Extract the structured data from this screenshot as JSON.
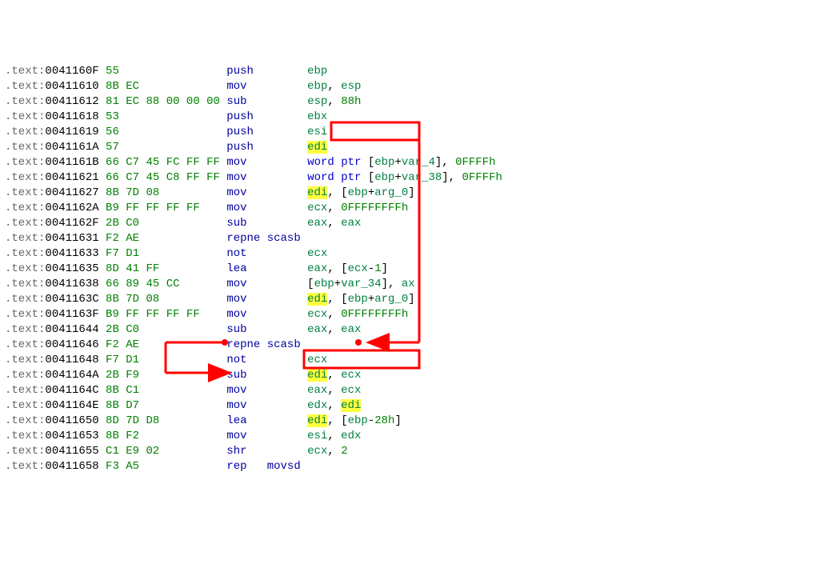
{
  "seg": ".text:",
  "rows": [
    {
      "addr": "0041160F",
      "bytes": [
        "55"
      ],
      "m": "push",
      "ops": [
        [
          "reg",
          "ebp"
        ]
      ]
    },
    {
      "addr": "00411610",
      "bytes": [
        "8B",
        "EC"
      ],
      "m": "mov",
      "ops": [
        [
          "reg",
          "ebp"
        ],
        [
          "punc",
          ", "
        ],
        [
          "reg",
          "esp"
        ]
      ]
    },
    {
      "addr": "00411612",
      "bytes": [
        "81",
        "EC",
        "88",
        "00",
        "00",
        "00"
      ],
      "m": "sub",
      "ops": [
        [
          "reg",
          "esp"
        ],
        [
          "punc",
          ", "
        ],
        [
          "num",
          "88h"
        ]
      ]
    },
    {
      "addr": "00411618",
      "bytes": [
        "53"
      ],
      "m": "push",
      "ops": [
        [
          "reg",
          "ebx"
        ]
      ]
    },
    {
      "addr": "00411619",
      "bytes": [
        "56"
      ],
      "m": "push",
      "ops": [
        [
          "reg",
          "esi"
        ]
      ]
    },
    {
      "addr": "0041161A",
      "bytes": [
        "57"
      ],
      "m": "push",
      "ops": [
        [
          "edi-hl",
          "edi"
        ]
      ]
    },
    {
      "addr": "0041161B",
      "bytes": [
        "66",
        "C7",
        "45",
        "FC",
        "FF",
        "FF"
      ],
      "m": "mov",
      "ops": [
        [
          "blueop",
          "word ptr "
        ],
        [
          "punc",
          "["
        ],
        [
          "reg",
          "ebp"
        ],
        [
          "punc",
          "+"
        ],
        [
          "reg",
          "var_4"
        ],
        [
          "punc",
          "]"
        ],
        [
          "punc",
          ", "
        ],
        [
          "num",
          "0FFFFh"
        ]
      ]
    },
    {
      "addr": "00411621",
      "bytes": [
        "66",
        "C7",
        "45",
        "C8",
        "FF",
        "FF"
      ],
      "m": "mov",
      "ops": [
        [
          "blueop",
          "word ptr "
        ],
        [
          "punc",
          "["
        ],
        [
          "reg",
          "ebp"
        ],
        [
          "punc",
          "+"
        ],
        [
          "reg",
          "var_38"
        ],
        [
          "punc",
          "]"
        ],
        [
          "punc",
          ", "
        ],
        [
          "num",
          "0FFFFh"
        ]
      ]
    },
    {
      "addr": "00411627",
      "bytes": [
        "8B",
        "7D",
        "08"
      ],
      "m": "mov",
      "ops": [
        [
          "edi-hl",
          "edi"
        ],
        [
          "punc",
          ", "
        ],
        [
          "punc",
          "["
        ],
        [
          "reg",
          "ebp"
        ],
        [
          "punc",
          "+"
        ],
        [
          "reg",
          "arg_0"
        ],
        [
          "punc",
          "]"
        ]
      ]
    },
    {
      "addr": "0041162A",
      "bytes": [
        "B9",
        "FF",
        "FF",
        "FF",
        "FF"
      ],
      "m": "mov",
      "ops": [
        [
          "reg",
          "ecx"
        ],
        [
          "punc",
          ", "
        ],
        [
          "num",
          "0FFFFFFFFh"
        ]
      ]
    },
    {
      "addr": "0041162F",
      "bytes": [
        "2B",
        "C0"
      ],
      "m": "sub",
      "ops": [
        [
          "reg",
          "eax"
        ],
        [
          "punc",
          ", "
        ],
        [
          "reg",
          "eax"
        ]
      ]
    },
    {
      "addr": "00411631",
      "bytes": [
        "F2",
        "AE"
      ],
      "m": "repne scasb",
      "ops": []
    },
    {
      "addr": "00411633",
      "bytes": [
        "F7",
        "D1"
      ],
      "m": "not",
      "ops": [
        [
          "reg",
          "ecx"
        ]
      ]
    },
    {
      "addr": "00411635",
      "bytes": [
        "8D",
        "41",
        "FF"
      ],
      "m": "lea",
      "ops": [
        [
          "reg",
          "eax"
        ],
        [
          "punc",
          ", "
        ],
        [
          "punc",
          "["
        ],
        [
          "reg",
          "ecx"
        ],
        [
          "punc",
          "-"
        ],
        [
          "num",
          "1"
        ],
        [
          "punc",
          "]"
        ]
      ]
    },
    {
      "addr": "00411638",
      "bytes": [
        "66",
        "89",
        "45",
        "CC"
      ],
      "m": "mov",
      "ops": [
        [
          "punc",
          "["
        ],
        [
          "reg",
          "ebp"
        ],
        [
          "punc",
          "+"
        ],
        [
          "reg",
          "var_34"
        ],
        [
          "punc",
          "]"
        ],
        [
          "punc",
          ", "
        ],
        [
          "reg",
          "ax"
        ]
      ]
    },
    {
      "addr": "0041163C",
      "bytes": [
        "8B",
        "7D",
        "08"
      ],
      "m": "mov",
      "ops": [
        [
          "edi-hl",
          "edi"
        ],
        [
          "punc",
          ", "
        ],
        [
          "punc",
          "["
        ],
        [
          "reg",
          "ebp"
        ],
        [
          "punc",
          "+"
        ],
        [
          "reg",
          "arg_0"
        ],
        [
          "punc",
          "]"
        ]
      ]
    },
    {
      "addr": "0041163F",
      "bytes": [
        "B9",
        "FF",
        "FF",
        "FF",
        "FF"
      ],
      "m": "mov",
      "ops": [
        [
          "reg",
          "ecx"
        ],
        [
          "punc",
          ", "
        ],
        [
          "num",
          "0FFFFFFFFh"
        ]
      ]
    },
    {
      "addr": "00411644",
      "bytes": [
        "2B",
        "C0"
      ],
      "m": "sub",
      "ops": [
        [
          "reg",
          "eax"
        ],
        [
          "punc",
          ", "
        ],
        [
          "reg",
          "eax"
        ]
      ]
    },
    {
      "addr": "00411646",
      "bytes": [
        "F2",
        "AE"
      ],
      "m": "repne scasb",
      "ops": []
    },
    {
      "addr": "00411648",
      "bytes": [
        "F7",
        "D1"
      ],
      "m": "not",
      "ops": [
        [
          "reg",
          "ecx"
        ]
      ]
    },
    {
      "addr": "0041164A",
      "bytes": [
        "2B",
        "F9"
      ],
      "m": "sub",
      "ops": [
        [
          "edi-hl",
          "edi"
        ],
        [
          "punc",
          ", "
        ],
        [
          "reg",
          "ecx"
        ]
      ]
    },
    {
      "addr": "0041164C",
      "bytes": [
        "8B",
        "C1"
      ],
      "m": "mov",
      "ops": [
        [
          "reg",
          "eax"
        ],
        [
          "punc",
          ", "
        ],
        [
          "reg",
          "ecx"
        ]
      ]
    },
    {
      "addr": "0041164E",
      "bytes": [
        "8B",
        "D7"
      ],
      "m": "mov",
      "ops": [
        [
          "reg",
          "edx"
        ],
        [
          "punc",
          ", "
        ],
        [
          "edi-hl",
          "edi"
        ]
      ]
    },
    {
      "addr": "00411650",
      "bytes": [
        "8D",
        "7D",
        "D8"
      ],
      "m": "lea",
      "ops": [
        [
          "edi-hl",
          "edi"
        ],
        [
          "punc",
          ", "
        ],
        [
          "punc",
          "["
        ],
        [
          "reg",
          "ebp"
        ],
        [
          "punc",
          "-"
        ],
        [
          "num",
          "28h"
        ],
        [
          "punc",
          "]"
        ]
      ]
    },
    {
      "addr": "00411653",
      "bytes": [
        "8B",
        "F2"
      ],
      "m": "mov",
      "ops": [
        [
          "reg",
          "esi"
        ],
        [
          "punc",
          ", "
        ],
        [
          "reg",
          "edx"
        ]
      ]
    },
    {
      "addr": "00411655",
      "bytes": [
        "C1",
        "E9",
        "02"
      ],
      "m": "shr",
      "ops": [
        [
          "reg",
          "ecx"
        ],
        [
          "punc",
          ", "
        ],
        [
          "num",
          "2"
        ]
      ]
    },
    {
      "addr": "00411658",
      "bytes": [
        "F3",
        "A5"
      ],
      "m": "rep movsd",
      "ops": []
    }
  ],
  "annotation_color": "#ff0000",
  "chart_data": null
}
